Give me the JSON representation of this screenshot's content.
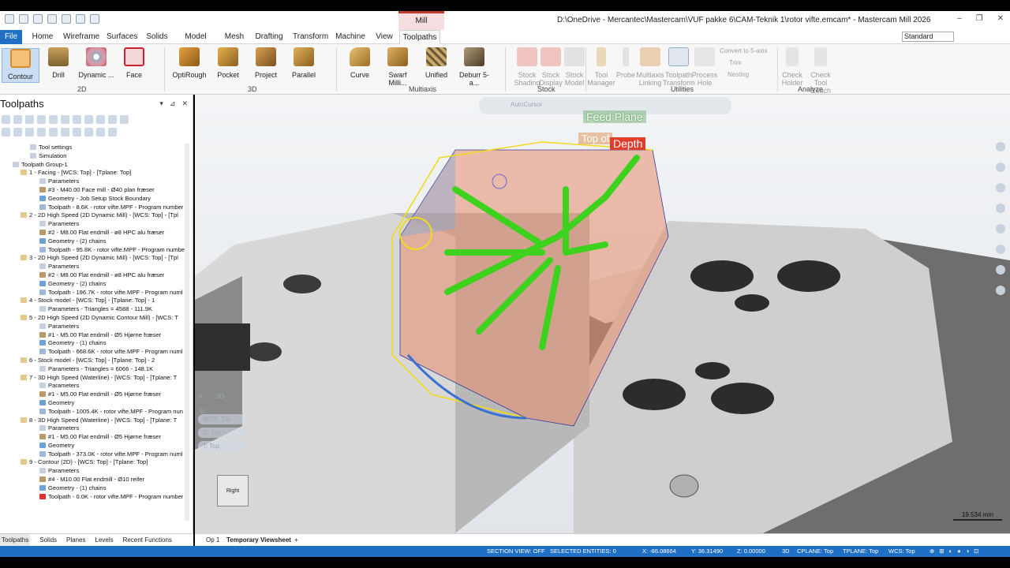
{
  "title_bar": {
    "context_tab": "Mill",
    "window_title": "D:\\OneDrive - Mercantec\\Mastercam\\VUF pakke 6\\CAM-Teknik 1\\rotor vifte.emcam* - Mastercam Mill 2026",
    "win_minimize": "–",
    "win_restore": "❐",
    "win_close": "✕"
  },
  "ribbon_tabs": [
    "File",
    "Home",
    "Wireframe",
    "Surfaces",
    "Solids",
    "Model Prep",
    "Mesh",
    "Drafting",
    "Transform",
    "Machine",
    "View",
    "Toolpaths"
  ],
  "config_select": "Standard",
  "ribbon": {
    "groups": {
      "g2d": "2D",
      "g3d": "3D",
      "multiaxis": "Multiaxis",
      "stock": "Stock",
      "utilities": "Utilities",
      "analyze": "Analyze"
    },
    "buttons": {
      "contour": "Contour",
      "drill": "Drill",
      "dynamic": "Dynamic ...",
      "face": "Face",
      "optirough": "OptiRough",
      "pocket": "Pocket",
      "project": "Project",
      "parallel": "Parallel",
      "curve": "Curve",
      "swarf": "Swarf Milli...",
      "unified": "Unified",
      "deburr": "Deburr 5-a...",
      "stock_shading": "Stock Shading",
      "stock_display": "Stock Display",
      "stock_model": "Stock Model",
      "tool_manager": "Tool Manager",
      "probe": "Probe",
      "multiaxis_linking": "Multiaxis Linking",
      "toolpath_transform": "Toolpath Transform",
      "process_hole": "Process Hole",
      "convert_5axis": "Convert to 5-axis",
      "trim": "Trim",
      "nesting": "Nesting",
      "check_holder": "Check Holder",
      "check_tool_reach": "Check Tool Reach"
    }
  },
  "toolpaths_panel": {
    "title": "Toolpaths",
    "tree": [
      "Tool settings",
      "Simulation",
      "Toolpath Group-1",
      "1 - Facing - [WCS: Top] - [Tplane: Top]",
      "Parameters",
      "#3 - M40.00 Face mill - Ø40 plan fræser",
      "Geometry - Job Setup Stock Boundary",
      "Toolpath - 8.6K - rotor vifte.MPF - Program number",
      "2 - 2D High Speed (2D Dynamic Mill) - [WCS: Top] - [Tpl",
      "Parameters",
      "#2 - M8.00 Flat endmill - ø8 HPC alu fræser",
      "Geometry - (2) chains",
      "Toolpath - 95.8K - rotor vifte.MPF - Program numbe",
      "3 - 2D High Speed (2D Dynamic Mill) - [WCS: Top] - [Tpl",
      "Parameters",
      "#2 - M8.00 Flat endmill - ø8 HPC alu fræser",
      "Geometry - (2) chains",
      "Toolpath - 196.7K - rotor vifte.MPF - Program numl",
      "4 - Stock model - [WCS: Top] - [Tplane: Top] - 1",
      "Parameters - Triangles = 4588 - 111.9K",
      "5 - 2D High Speed (2D Dynamic Contour Mill) - [WCS: T",
      "Parameters",
      "#1 - M5.00 Flat endmill - Ø5 Hjørne fræser",
      "Geometry - (1) chains",
      "Toolpath - 668.6K - rotor vifte.MPF - Program numl",
      "6 - Stock model - [WCS: Top] - [Tplane: Top] - 2",
      "Parameters - Triangles = 6066 - 148.1K",
      "7 - 3D High Speed (Waterline) - [WCS: Top] - [Tplane: T",
      "Parameters",
      "#1 - M5.00 Flat endmill - Ø5 Hjørne fræser",
      "Geometry",
      "Toolpath - 1005.4K - rotor vifte.MPF - Program nun",
      "8 - 3D High Speed (Waterline) - [WCS: Top] - [Tplane: T",
      "Parameters",
      "#1 - M5.00 Flat endmill - Ø5 Hjørne fræser",
      "Geometry",
      "Toolpath - 373.0K - rotor vifte.MPF - Program numl",
      "9 - Contour (2D) - [WCS: Top] - [Tplane: Top]",
      "Parameters",
      "#4 - M10.00 Flat endmill - Ø10 reifer",
      "Geometry - (1) chains",
      "Toolpath - 0.0K - rotor vifte.MPF - Program number"
    ]
  },
  "manager_tabs": [
    "Toolpaths",
    "Solids",
    "Planes",
    "Levels",
    "Recent Functions"
  ],
  "viewport": {
    "feed_plane": "Feed Plane",
    "top_of": "Top of",
    "depth": "Depth",
    "autocursor": "AutoCursor",
    "wcs": "WCS: Top",
    "cplane": "C: Top",
    "tplane": "T: Top",
    "g_label": "G:",
    "view_cube": "Right",
    "scale": "19.534 mm",
    "badge_3d": "3D"
  },
  "view_tabs": {
    "op": "Op 1",
    "sheet": "Temporary Viewsheet",
    "add": "+"
  },
  "status_bar": {
    "section_view": "SECTION VIEW: OFF",
    "selected": "SELECTED ENTITIES: 0",
    "x": "X:    -86.08664",
    "y": "Y:    36.31490",
    "z": "Z:    0.00000",
    "mode": "3D",
    "cplane": "CPLANE: Top",
    "tplane": "TPLANE: Top",
    "wcs": "WCS: Top"
  },
  "colors": {
    "accent_blue": "#1f6fc4",
    "toolpath_green": "#3cd21e",
    "toolpath_yellow": "#f0dc1e",
    "depth_red": "#e23c2a"
  }
}
